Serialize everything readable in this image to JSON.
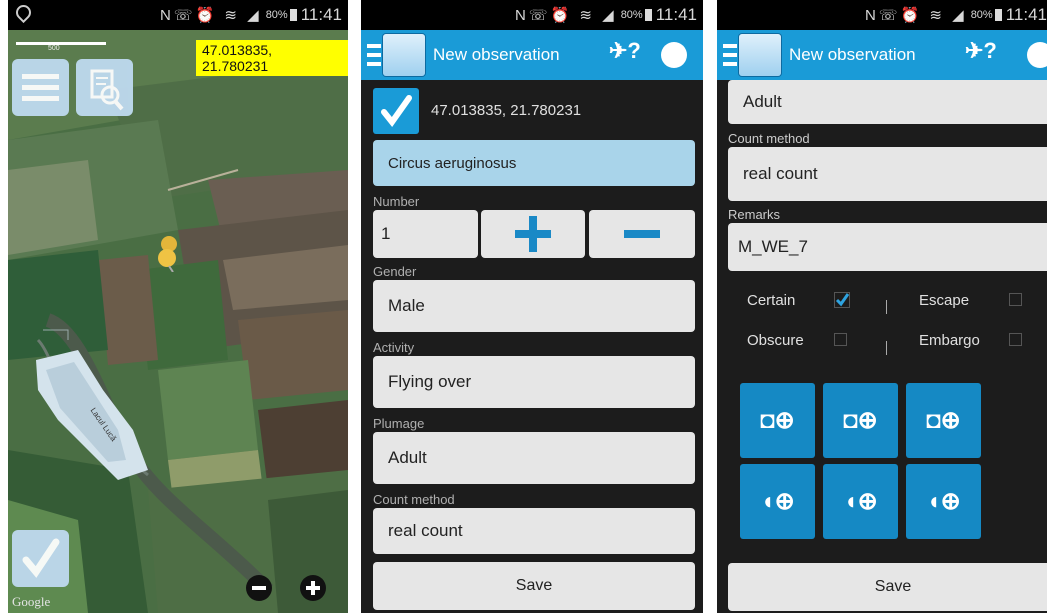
{
  "status": {
    "time": "11:41",
    "battery": "80%"
  },
  "map": {
    "coordinates": "47.013835, 21.780231",
    "scale_text": "500",
    "provider": "Google",
    "lake_label": "Lacul Lucă"
  },
  "form": {
    "title": "New observation",
    "coordinates": "47.013835, 21.780231",
    "species": "Circus aeruginosus",
    "number_label": "Number",
    "number_value": "1",
    "gender_label": "Gender",
    "gender_value": "Male",
    "activity_label": "Activity",
    "activity_value": "Flying over",
    "plumage_label": "Plumage",
    "plumage_value": "Adult",
    "count_method_label": "Count method",
    "count_method_value": "real count",
    "remarks_label": "Remarks",
    "remarks_value": "M_WE_7",
    "save_label": "Save"
  },
  "checkboxes": [
    {
      "label": "Certain",
      "checked": true
    },
    {
      "label": "Escape",
      "checked": false
    },
    {
      "label": "Obscure",
      "checked": false
    },
    {
      "label": "Embargo",
      "checked": false
    }
  ],
  "media_buttons": [
    "add-photo",
    "add-photo",
    "add-photo",
    "add-audio",
    "add-audio",
    "add-audio"
  ],
  "colors": {
    "accent": "#1a9bd7",
    "button_blue": "#1589c4",
    "highlight": "#ffff00"
  }
}
